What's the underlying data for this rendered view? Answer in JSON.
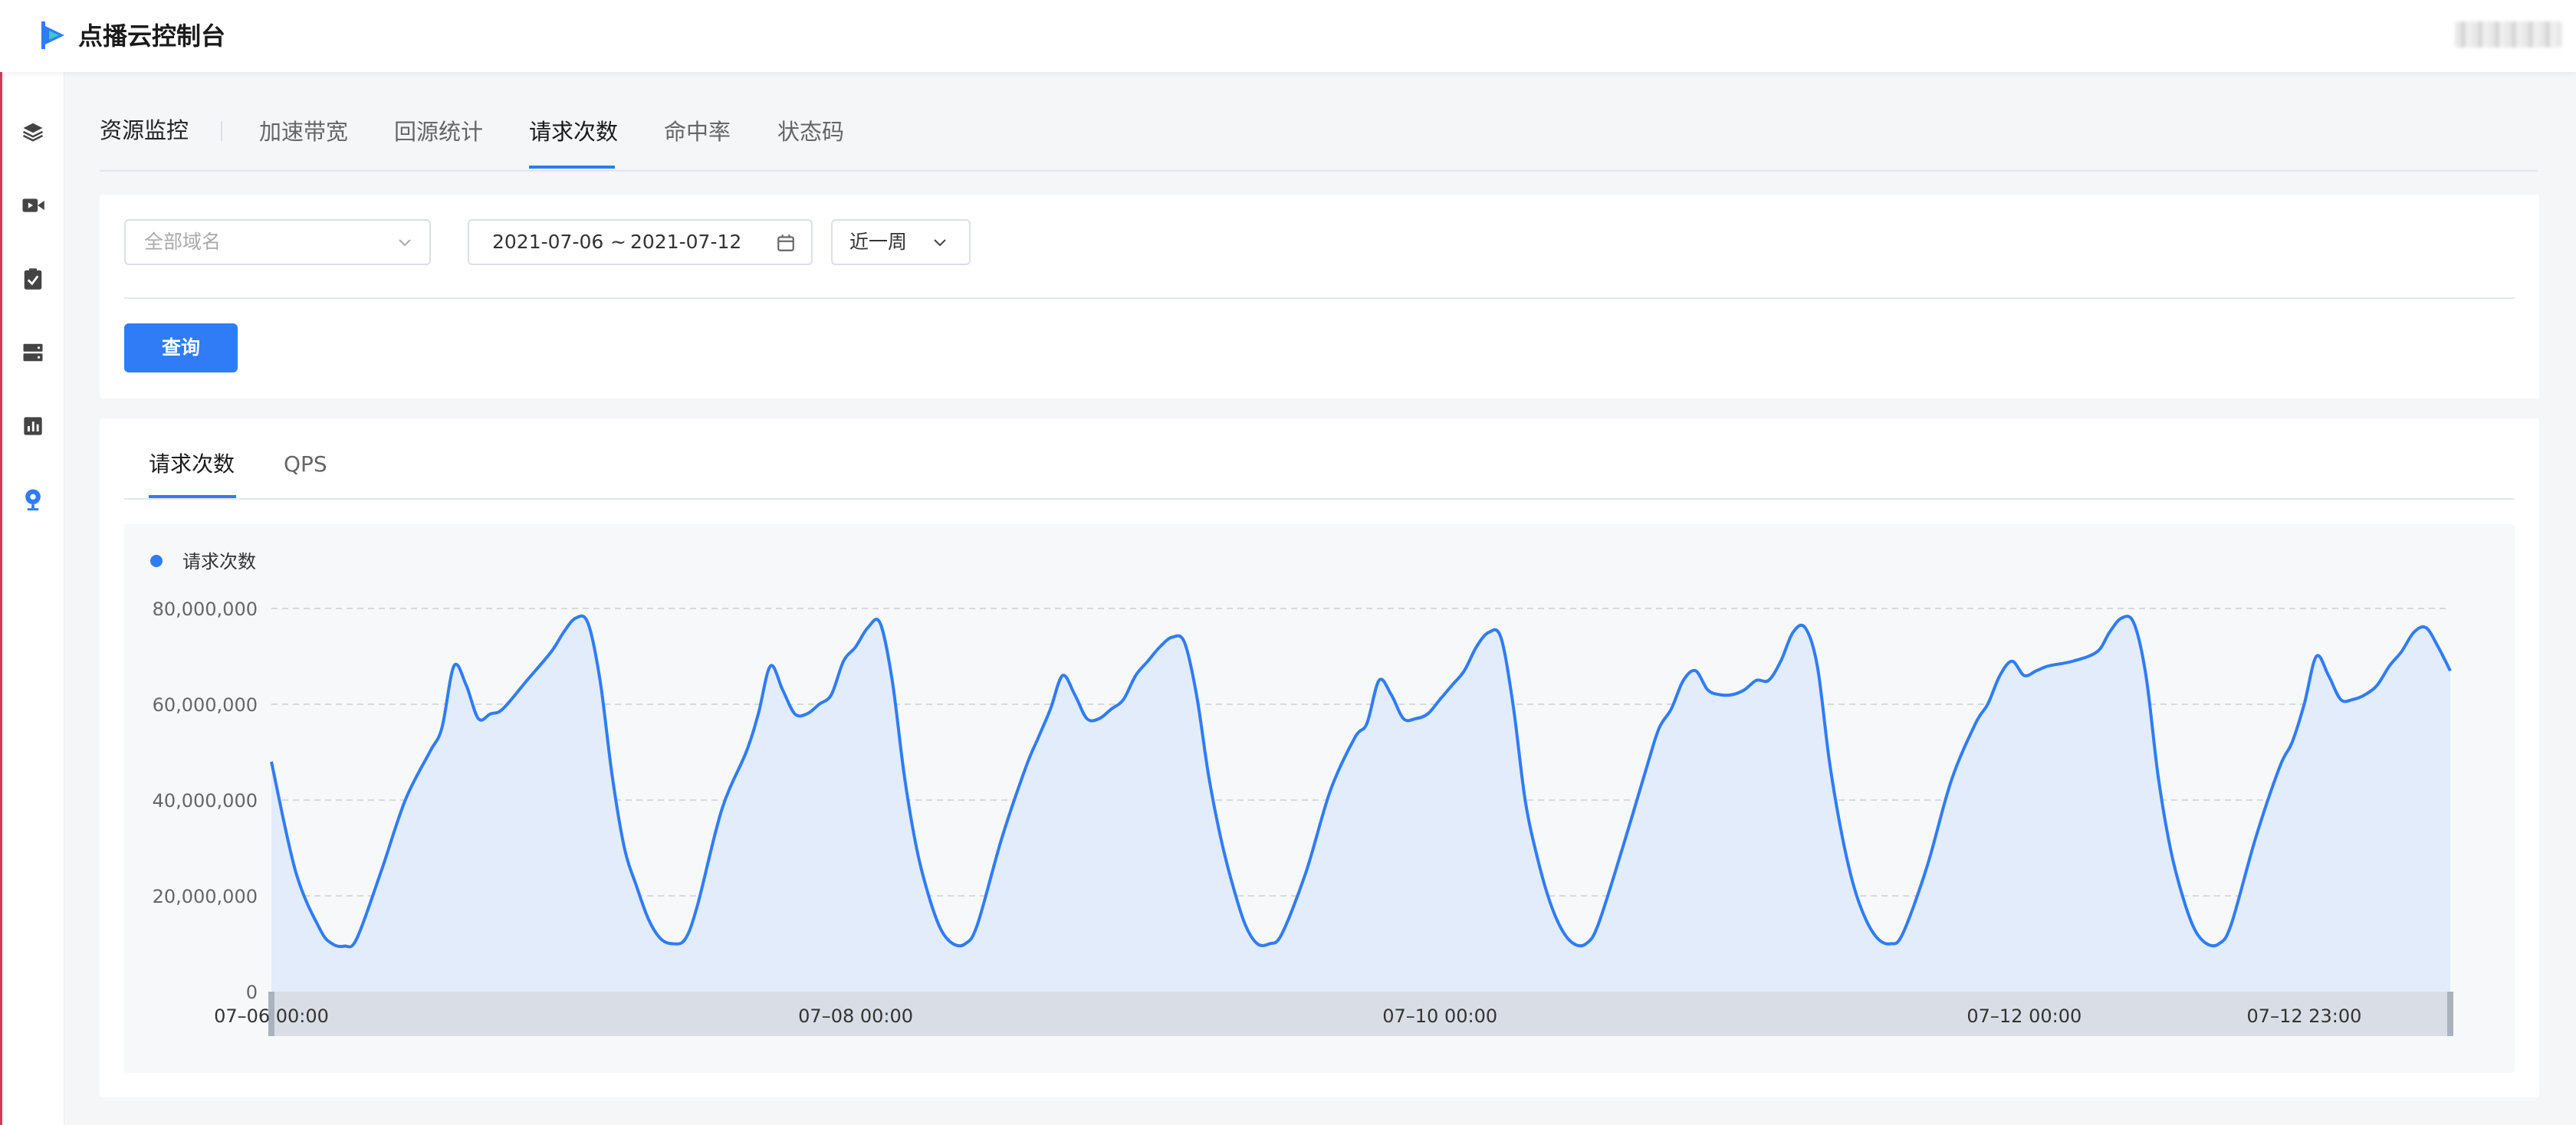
{
  "app": {
    "title": "点播云控制台"
  },
  "sidebar": {
    "icons": [
      "layers-icon",
      "video-icon",
      "clipboard-check-icon",
      "server-icon",
      "bar-chart-icon",
      "monitor-icon"
    ]
  },
  "nav": {
    "breadcrumb": "资源监控",
    "tabs": [
      {
        "label": "加速带宽"
      },
      {
        "label": "回源统计"
      },
      {
        "label": "请求次数"
      },
      {
        "label": "命中率"
      },
      {
        "label": "状态码"
      }
    ],
    "active_tab": "请求次数"
  },
  "filters": {
    "domain_placeholder": "全部域名",
    "date_start": "2021-07-06",
    "date_sep": "~",
    "date_end": "2021-07-12",
    "range": "近一周",
    "query_label": "查询"
  },
  "chart_tabs": [
    {
      "label": "请求次数"
    },
    {
      "label": "QPS"
    }
  ],
  "colors": {
    "accent": "#2f7cf6",
    "area": "#e3ecfa"
  },
  "chart_data": {
    "type": "area",
    "legend": "top-left",
    "grid": true,
    "series": [
      {
        "name": "请求次数"
      }
    ],
    "ylim": [
      0,
      80000000
    ],
    "yticks": [
      {
        "v": 0,
        "label": "0"
      },
      {
        "v": 20000000,
        "label": "20,000,000"
      },
      {
        "v": 40000000,
        "label": "40,000,000"
      },
      {
        "v": 60000000,
        "label": "60,000,000"
      },
      {
        "v": 80000000,
        "label": "80,000,000"
      }
    ],
    "xlim": [
      0,
      167
    ],
    "xticks": [
      {
        "h": 0,
        "label": "07–06 00:00"
      },
      {
        "h": 48,
        "label": "07–08 00:00"
      },
      {
        "h": 96,
        "label": "07–10 00:00"
      },
      {
        "h": 144,
        "label": "07–12 00:00"
      },
      {
        "h": 167,
        "label": "07–12 23:00"
      }
    ],
    "points": [
      [
        0,
        48000000
      ],
      [
        2,
        25000000
      ],
      [
        4,
        13000000
      ],
      [
        5,
        10000000
      ],
      [
        6,
        9500000
      ],
      [
        7,
        11000000
      ],
      [
        9,
        25000000
      ],
      [
        11,
        40000000
      ],
      [
        13,
        50000000
      ],
      [
        14,
        55000000
      ],
      [
        15,
        68000000
      ],
      [
        16,
        64000000
      ],
      [
        17,
        57000000
      ],
      [
        18,
        58000000
      ],
      [
        19,
        59000000
      ],
      [
        21,
        65000000
      ],
      [
        23,
        71000000
      ],
      [
        24,
        75000000
      ],
      [
        25,
        78000000
      ],
      [
        26,
        77000000
      ],
      [
        27,
        65000000
      ],
      [
        28,
        45000000
      ],
      [
        29,
        30000000
      ],
      [
        30,
        22000000
      ],
      [
        31,
        15000000
      ],
      [
        32,
        11000000
      ],
      [
        33,
        10000000
      ],
      [
        34,
        11000000
      ],
      [
        35,
        18000000
      ],
      [
        37,
        38000000
      ],
      [
        39,
        50000000
      ],
      [
        40,
        58000000
      ],
      [
        41,
        68000000
      ],
      [
        42,
        63000000
      ],
      [
        43,
        58000000
      ],
      [
        44,
        58000000
      ],
      [
        45,
        60000000
      ],
      [
        46,
        62000000
      ],
      [
        47,
        69000000
      ],
      [
        48,
        72000000
      ],
      [
        49,
        76000000
      ],
      [
        50,
        77000000
      ],
      [
        51,
        65000000
      ],
      [
        52,
        45000000
      ],
      [
        53,
        30000000
      ],
      [
        54,
        20000000
      ],
      [
        55,
        13000000
      ],
      [
        56,
        10000000
      ],
      [
        57,
        10000000
      ],
      [
        58,
        14000000
      ],
      [
        60,
        32000000
      ],
      [
        62,
        47000000
      ],
      [
        63,
        53000000
      ],
      [
        64,
        59000000
      ],
      [
        65,
        66000000
      ],
      [
        66,
        62000000
      ],
      [
        67,
        57000000
      ],
      [
        68,
        57000000
      ],
      [
        69,
        59000000
      ],
      [
        70,
        61000000
      ],
      [
        71,
        66000000
      ],
      [
        72,
        69000000
      ],
      [
        73,
        72000000
      ],
      [
        74,
        74000000
      ],
      [
        75,
        73000000
      ],
      [
        76,
        62000000
      ],
      [
        77,
        45000000
      ],
      [
        78,
        32000000
      ],
      [
        79,
        22000000
      ],
      [
        80,
        14000000
      ],
      [
        81,
        10000000
      ],
      [
        82,
        10000000
      ],
      [
        83,
        12000000
      ],
      [
        85,
        25000000
      ],
      [
        87,
        42000000
      ],
      [
        89,
        53000000
      ],
      [
        90,
        56000000
      ],
      [
        91,
        65000000
      ],
      [
        92,
        62000000
      ],
      [
        93,
        57000000
      ],
      [
        94,
        57000000
      ],
      [
        95,
        58000000
      ],
      [
        96,
        61000000
      ],
      [
        97,
        64000000
      ],
      [
        98,
        67000000
      ],
      [
        99,
        72000000
      ],
      [
        100,
        75000000
      ],
      [
        101,
        74000000
      ],
      [
        102,
        60000000
      ],
      [
        103,
        40000000
      ],
      [
        104,
        28000000
      ],
      [
        105,
        19000000
      ],
      [
        106,
        13000000
      ],
      [
        107,
        10000000
      ],
      [
        108,
        10000000
      ],
      [
        109,
        14000000
      ],
      [
        111,
        30000000
      ],
      [
        113,
        47000000
      ],
      [
        114,
        55000000
      ],
      [
        115,
        59000000
      ],
      [
        116,
        65000000
      ],
      [
        117,
        67000000
      ],
      [
        118,
        63000000
      ],
      [
        119,
        62000000
      ],
      [
        120,
        62000000
      ],
      [
        121,
        63000000
      ],
      [
        122,
        65000000
      ],
      [
        123,
        65000000
      ],
      [
        124,
        69000000
      ],
      [
        125,
        75000000
      ],
      [
        126,
        76000000
      ],
      [
        127,
        68000000
      ],
      [
        128,
        48000000
      ],
      [
        129,
        33000000
      ],
      [
        130,
        22000000
      ],
      [
        131,
        15000000
      ],
      [
        132,
        11000000
      ],
      [
        133,
        10000000
      ],
      [
        134,
        12000000
      ],
      [
        136,
        26000000
      ],
      [
        138,
        44000000
      ],
      [
        140,
        56000000
      ],
      [
        141,
        60000000
      ],
      [
        142,
        66000000
      ],
      [
        143,
        69000000
      ],
      [
        144,
        66000000
      ],
      [
        145,
        67000000
      ],
      [
        146,
        68000000
      ],
      [
        148,
        69000000
      ],
      [
        150,
        71000000
      ],
      [
        151,
        75000000
      ],
      [
        152,
        78000000
      ],
      [
        153,
        77000000
      ],
      [
        154,
        66000000
      ],
      [
        155,
        45000000
      ],
      [
        156,
        30000000
      ],
      [
        157,
        20000000
      ],
      [
        158,
        13000000
      ],
      [
        159,
        10000000
      ],
      [
        160,
        10000000
      ],
      [
        161,
        14000000
      ],
      [
        163,
        32000000
      ],
      [
        165,
        47000000
      ],
      [
        166,
        52000000
      ],
      [
        167,
        60000000
      ],
      [
        168,
        70000000
      ],
      [
        169,
        66000000
      ],
      [
        170,
        61000000
      ],
      [
        171,
        61000000
      ],
      [
        172,
        62000000
      ],
      [
        173,
        64000000
      ],
      [
        174,
        68000000
      ],
      [
        175,
        71000000
      ],
      [
        176,
        75000000
      ],
      [
        177,
        76000000
      ],
      [
        178,
        72000000
      ],
      [
        179,
        67000000
      ]
    ]
  }
}
